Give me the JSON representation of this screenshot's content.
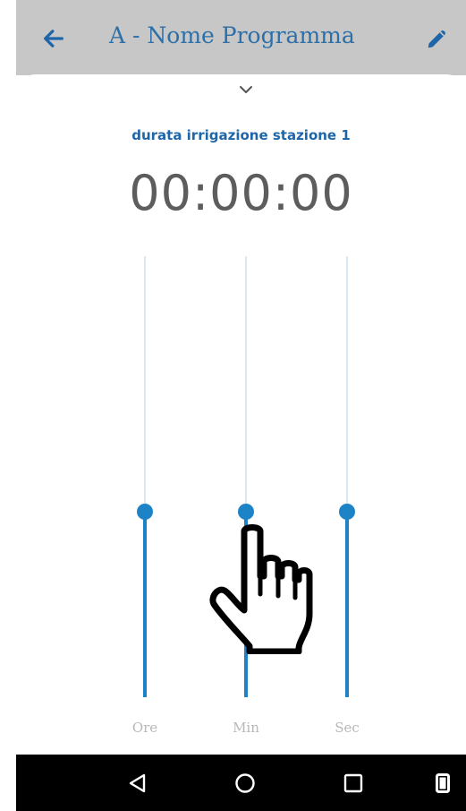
{
  "app_bar": {
    "title": "A - Nome Programma",
    "back_icon": "arrow-left-icon",
    "edit_icon": "pencil-icon",
    "background_color": "#c7c7c7",
    "title_color": "#2d6fa8"
  },
  "sheet": {
    "handle_icon": "chevron-down-icon",
    "title": "durata irrigazione stazione 1",
    "duration": "00:00:00"
  },
  "sliders": [
    {
      "label": "Ore",
      "value": 0.42,
      "thumb_color": "#1d83c7"
    },
    {
      "label": "Min",
      "value": 0.42,
      "thumb_color": "#1d83c7"
    },
    {
      "label": "Sec",
      "value": 0.42,
      "thumb_color": "#1d83c7"
    }
  ],
  "overlay": {
    "pointer_icon": "hand-pointer-icon"
  },
  "nav_bar": {
    "background_color": "#000000",
    "icons": [
      "nav-back-triangle-icon",
      "nav-home-circle-icon",
      "nav-recent-square-icon",
      "nav-extra-rectangle-icon"
    ]
  }
}
